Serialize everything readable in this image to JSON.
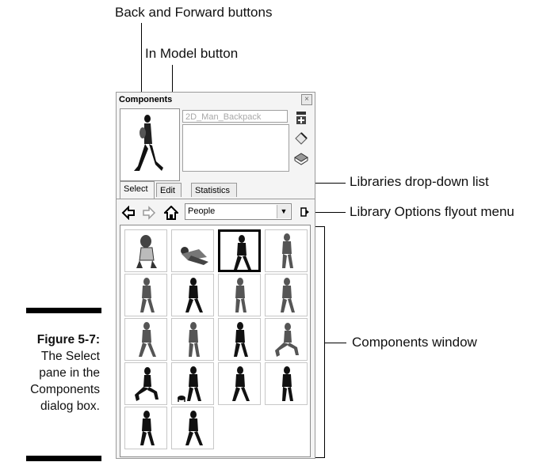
{
  "callouts": {
    "back_forward": "Back and Forward buttons",
    "in_model": "In Model button",
    "libraries_dropdown": "Libraries drop-down list",
    "library_options": "Library Options flyout menu",
    "components_window": "Components window"
  },
  "caption": {
    "figure": "Figure 5-7:",
    "line1": "The Select",
    "line2": "pane in the",
    "line3": "Components",
    "line4": "dialog box."
  },
  "dialog": {
    "title": "Components",
    "close": "×",
    "name_value": "2D_Man_Backpack",
    "tabs": [
      "Select",
      "Edit",
      "Statistics"
    ],
    "active_tab": "Select",
    "library_selected": "People",
    "icons": [
      "back-arrow-icon",
      "forward-arrow-icon",
      "home-icon",
      "details-flyout-icon",
      "create-component-icon",
      "paint-icon",
      "component-sheet-icon"
    ],
    "grid_items": [
      "woman-sitting",
      "couple-lying",
      "man-backpack-walking",
      "man-standing",
      "man-carrying",
      "old-man-walking",
      "child-walking",
      "woman-backpack",
      "man-walking-suit",
      "woman-walking",
      "woman-standing",
      "man-sitting",
      "man-kneeling",
      "woman-with-dog",
      "man-walking-silhouette",
      "man-striding",
      "woman-silhouette",
      "woman-bag-silhouette"
    ],
    "selected_item": "man-backpack-walking"
  }
}
